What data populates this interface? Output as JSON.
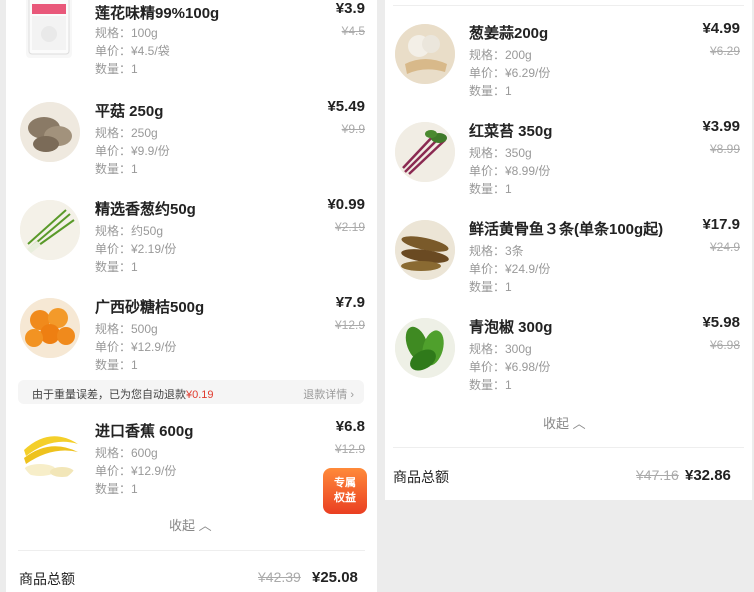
{
  "colors": {
    "accent_red": "#e03a2d",
    "badge_orange": "#ff6a2a"
  },
  "left": {
    "items": [
      {
        "title": "莲花味精99%100g",
        "spec": "规格：100g",
        "unit": "单价：¥4.5/袋",
        "qty": "数量：1",
        "price": "¥3.9",
        "original": "¥4.5",
        "icon": "msg-bag-image"
      },
      {
        "title": "平菇 250g",
        "spec": "规格：250g",
        "unit": "单价：¥9.9/份",
        "qty": "数量：1",
        "price": "¥5.49",
        "original": "¥9.9",
        "icon": "oyster-mushroom-image"
      },
      {
        "title": "精选香葱约50g",
        "spec": "规格：约50g",
        "unit": "单价：¥2.19/份",
        "qty": "数量：1",
        "price": "¥0.99",
        "original": "¥2.19",
        "icon": "scallion-image"
      },
      {
        "title": "广西砂糖桔500g",
        "spec": "规格：500g",
        "unit": "单价：¥12.9/份",
        "qty": "数量：1",
        "price": "¥7.9",
        "original": "¥12.9",
        "icon": "mandarin-image"
      },
      {
        "title": "进口香蕉 600g",
        "spec": "规格：600g",
        "unit": "单价：¥12.9/份",
        "qty": "数量：1",
        "price": "¥6.8",
        "original": "¥12.9",
        "icon": "banana-image"
      }
    ],
    "notice": {
      "text": "由于重量误差，已为您自动退款",
      "amount": "¥0.19",
      "detail": "退款详情 ›"
    },
    "badge": {
      "line1": "专属",
      "line2": "权益"
    },
    "collapse": "收起 ︿",
    "total": {
      "label": "商品总额",
      "original": "¥42.39",
      "price": "¥25.08"
    }
  },
  "right": {
    "items": [
      {
        "title": "葱姜蒜200g",
        "spec": "规格：200g",
        "unit": "单价：¥6.29/份",
        "qty": "数量：1",
        "price": "¥4.99",
        "original": "¥6.29",
        "icon": "garlic-ginger-image"
      },
      {
        "title": "红菜苔 350g",
        "spec": "规格：350g",
        "unit": "单价：¥8.99/份",
        "qty": "数量：1",
        "price": "¥3.99",
        "original": "¥8.99",
        "icon": "red-greens-image"
      },
      {
        "title": "鲜活黄骨鱼３条(单条100g起)",
        "spec": "规格：3条",
        "unit": "单价：¥24.9/份",
        "qty": "数量：1",
        "price": "¥17.9",
        "original": "¥24.9",
        "icon": "catfish-image"
      },
      {
        "title": "青泡椒 300g",
        "spec": "规格：300g",
        "unit": "单价：¥6.98/份",
        "qty": "数量：1",
        "price": "¥5.98",
        "original": "¥6.98",
        "icon": "green-pepper-image"
      }
    ],
    "collapse": "收起 ︿",
    "total": {
      "label": "商品总额",
      "original": "¥47.16",
      "price": "¥32.86"
    }
  }
}
